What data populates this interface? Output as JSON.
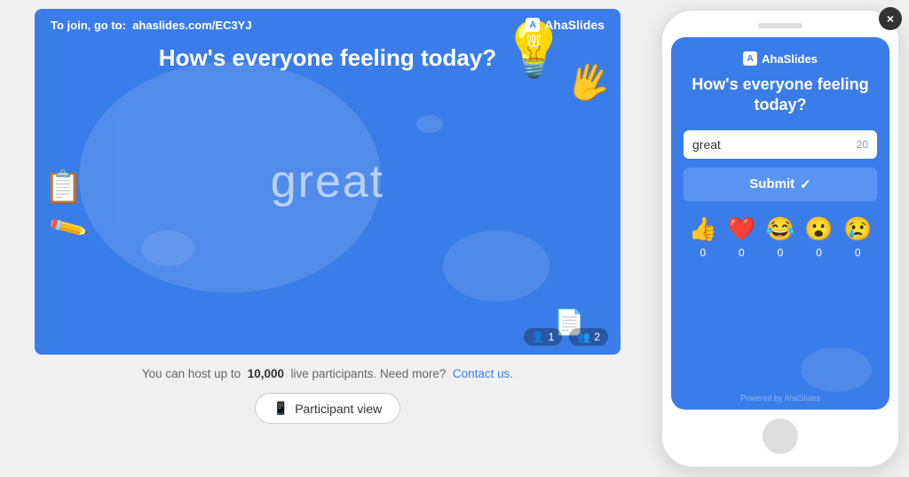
{
  "slide": {
    "join_prefix": "To join, go to:",
    "join_url": "ahaslides.com/EC3YJ",
    "brand": "AhaSlides",
    "question": "How's everyone feeling today?",
    "answer": "great",
    "participant_badge1": "1",
    "participant_badge2": "2"
  },
  "below": {
    "host_text_prefix": "You can host up to",
    "host_limit": "10,000",
    "host_text_suffix": "live participants. Need more?",
    "contact_link": "Contact us.",
    "participant_view_label": "Participant view"
  },
  "phone": {
    "brand": "AhaSlides",
    "question": "How's everyone feeling today?",
    "input_value": "great",
    "input_count": "20",
    "submit_label": "Submit",
    "submit_check": "✓",
    "reactions": [
      {
        "emoji": "👍",
        "count": "0"
      },
      {
        "emoji": "❤️",
        "count": "0"
      },
      {
        "emoji": "😂",
        "count": "0"
      },
      {
        "emoji": "😮",
        "count": "0"
      },
      {
        "emoji": "😢",
        "count": "0"
      }
    ],
    "powered_by": "Powered by AhaSlides",
    "close_label": "×"
  },
  "icons": {
    "phone_icon": "📱",
    "lightbulb": "💡",
    "hand_right": "✋",
    "notes": "📋",
    "pencil": "✏️",
    "paper": "📄",
    "person_icon": "👤",
    "people_icon": "👥"
  }
}
